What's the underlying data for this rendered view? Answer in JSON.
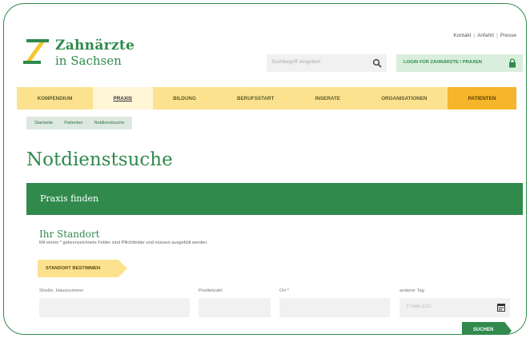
{
  "brand": {
    "title": "Zahnärzte",
    "subtitle": "in Sachsen",
    "colors": {
      "green": "#2f8a4c",
      "yellow": "#fce28e",
      "orange": "#f6b52a"
    }
  },
  "topnav": {
    "items": [
      "Kontakt",
      "Anfahrt",
      "Presse"
    ]
  },
  "search": {
    "placeholder": "Suchbegriff eingeben",
    "icon": "search-icon"
  },
  "login": {
    "label": "LOGIN FÜR ZAHNÄRZTE / PRAXEN",
    "icon": "lock-icon"
  },
  "mainnav": {
    "items": [
      {
        "label": "KOMPENDIUM"
      },
      {
        "label": "PRAXIS"
      },
      {
        "label": "BILDUNG"
      },
      {
        "label": "BERUFSSTART"
      },
      {
        "label": "INSERATE"
      },
      {
        "label": "ORGANISATIONEN"
      },
      {
        "label": "PATIENTEN"
      }
    ]
  },
  "breadcrumb": [
    "Startseite",
    "Patienten",
    "Notdienstsuche"
  ],
  "page": {
    "title": "Notdienstsuche"
  },
  "panel": {
    "title": "Praxis finden"
  },
  "location": {
    "title": "Ihr Standort",
    "hint": "Mit einem * gekennzeichnete Felder sind Pflichtfelder und müssen ausgefüllt werden.",
    "button": "STANDORT BESTIMMEN"
  },
  "form": {
    "street": {
      "label": "Straße, Hausnummer",
      "value": ""
    },
    "zip": {
      "label": "Postleitzahl",
      "value": ""
    },
    "city": {
      "label": "Ort *",
      "value": ""
    },
    "date": {
      "label": "anderer Tag",
      "placeholder": "TT.MM.JJJJ"
    },
    "submit": "SUCHEN"
  }
}
